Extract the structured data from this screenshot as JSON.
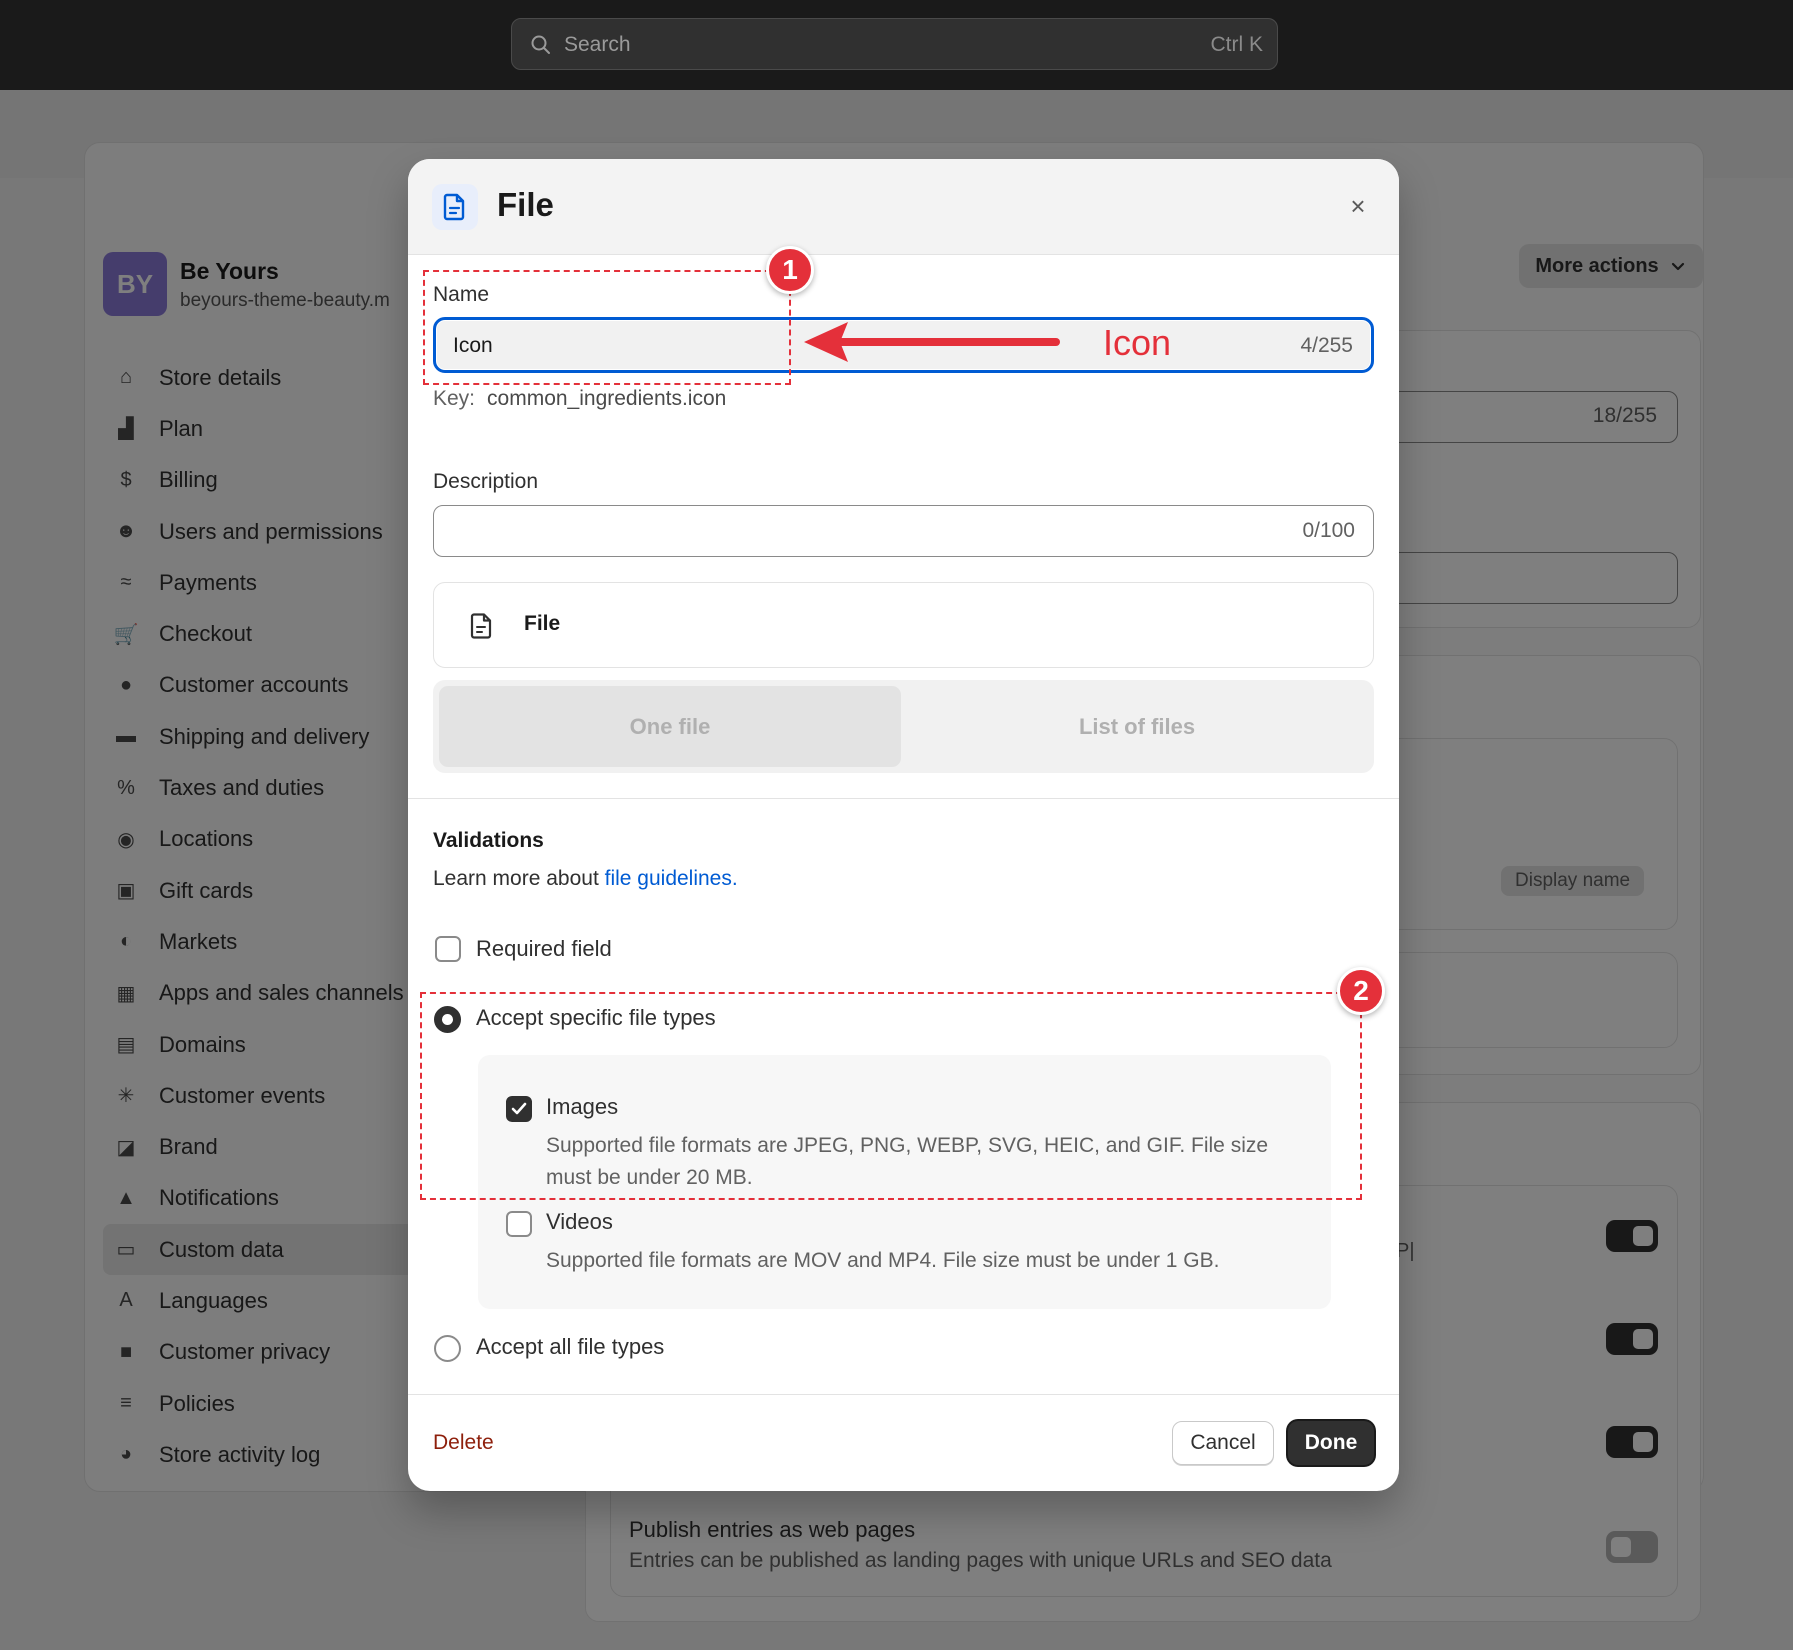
{
  "topbar": {
    "search_placeholder": "Search",
    "shortcut": "Ctrl K"
  },
  "store": {
    "initials": "BY",
    "name": "Be Yours",
    "url": "beyours-theme-beauty.m"
  },
  "sidebar": {
    "items": [
      {
        "label": "Store details",
        "icon": "store-icon"
      },
      {
        "label": "Plan",
        "icon": "plan-icon"
      },
      {
        "label": "Billing",
        "icon": "billing-icon"
      },
      {
        "label": "Users and permissions",
        "icon": "users-icon"
      },
      {
        "label": "Payments",
        "icon": "payments-icon"
      },
      {
        "label": "Checkout",
        "icon": "cart-icon"
      },
      {
        "label": "Customer accounts",
        "icon": "person-icon"
      },
      {
        "label": "Shipping and delivery",
        "icon": "truck-icon"
      },
      {
        "label": "Taxes and duties",
        "icon": "tax-icon"
      },
      {
        "label": "Locations",
        "icon": "location-icon"
      },
      {
        "label": "Gift cards",
        "icon": "gift-card-icon"
      },
      {
        "label": "Markets",
        "icon": "globe-icon"
      },
      {
        "label": "Apps and sales channels",
        "icon": "apps-icon"
      },
      {
        "label": "Domains",
        "icon": "domains-icon"
      },
      {
        "label": "Customer events",
        "icon": "cursor-icon"
      },
      {
        "label": "Brand",
        "icon": "brand-icon"
      },
      {
        "label": "Notifications",
        "icon": "bell-icon"
      },
      {
        "label": "Custom data",
        "icon": "custom-data-icon",
        "active": true
      },
      {
        "label": "Languages",
        "icon": "languages-icon"
      },
      {
        "label": "Customer privacy",
        "icon": "lock-icon"
      },
      {
        "label": "Policies",
        "icon": "policies-icon"
      },
      {
        "label": "Store activity log",
        "icon": "activity-icon"
      }
    ]
  },
  "background": {
    "more_actions": "More actions",
    "count_1": "18/255",
    "display_name_pill": "Display name",
    "publish_title": "Publish entries as web pages",
    "publish_desc": "Entries can be published as landing pages with unique URLs and SEO data",
    "fragment": "P|"
  },
  "modal": {
    "title": "File",
    "name_label": "Name",
    "name_value": "Icon",
    "name_count": "4/255",
    "key_label": "Key:",
    "key_value": "common_ingredients.icon",
    "description_label": "Description",
    "description_count": "0/100",
    "file_type_label": "File",
    "segment_one": "One file",
    "segment_list": "List of files",
    "validations_title": "Validations",
    "learn_more": "Learn more about ",
    "learn_link": "file guidelines.",
    "required_field": "Required field",
    "accept_specific": "Accept specific file types",
    "images_label": "Images",
    "images_hint": "Supported file formats are JPEG, PNG, WEBP, SVG, HEIC, and GIF. File size must be under 20 MB.",
    "videos_label": "Videos",
    "videos_hint": "Supported file formats are MOV and MP4. File size must be under 1 GB.",
    "accept_all": "Accept all file types",
    "delete": "Delete",
    "cancel": "Cancel",
    "done": "Done"
  },
  "annotations": {
    "badge_1": "1",
    "badge_2": "2",
    "arrow_text": "Icon",
    "color": "#e4303a"
  },
  "colors": {
    "accent": "#005bd3",
    "primary_button": "#303030",
    "danger": "#8e1f0b"
  }
}
